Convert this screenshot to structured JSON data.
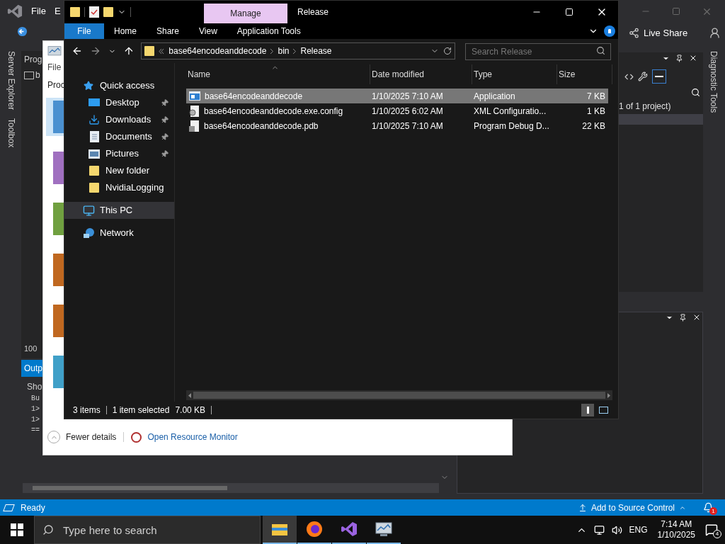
{
  "vs": {
    "menu": [
      "File",
      "E"
    ],
    "left_tabs": [
      "Server Explorer",
      "Toolbox"
    ],
    "right_tab": "Diagnostic Tools",
    "doc_tab": "Prog",
    "doc_item": "b",
    "zoom": "100",
    "output_tab": "Outp",
    "output_show": "Sho",
    "output_lines": [
      "Bu",
      "1>",
      "1>",
      "=="
    ],
    "solution_text": "1 of 1 project)",
    "live_share": "Live Share",
    "status": {
      "text": "Ready",
      "source_control": "Add to Source Control",
      "notifications": "1"
    }
  },
  "task_manager": {
    "menu": "File",
    "tab": "Proc",
    "fewer_details": "Fewer details",
    "resource_monitor": "Open Resource Monitor",
    "graphs": [
      {
        "color": "#4a90d0",
        "selected": true
      },
      {
        "color": "#a070c0",
        "selected": false
      },
      {
        "color": "#70a040",
        "selected": false
      },
      {
        "color": "#c06820",
        "selected": false
      },
      {
        "color": "#c06820",
        "selected": false
      },
      {
        "color": "#40a0c8",
        "selected": false
      }
    ]
  },
  "explorer": {
    "context_tab": "Manage",
    "title": "Release",
    "ribbon_tabs": [
      {
        "label": "File",
        "kind": "menu"
      },
      {
        "label": "Home",
        "kind": "tab"
      },
      {
        "label": "Share",
        "kind": "tab"
      },
      {
        "label": "View",
        "kind": "tab"
      },
      {
        "label": "Application Tools",
        "kind": "tab"
      }
    ],
    "breadcrumb": [
      "base64encodeanddecode",
      "bin",
      "Release"
    ],
    "search": {
      "placeholder": "Search Release"
    },
    "nav": [
      {
        "label": "Quick access",
        "kind": "star",
        "selected": false,
        "children": [
          {
            "label": "Desktop",
            "kind": "desktop",
            "pinned": true,
            "selected": false
          },
          {
            "label": "Downloads",
            "kind": "download",
            "pinned": true,
            "selected": false
          },
          {
            "label": "Documents",
            "kind": "document",
            "pinned": true,
            "selected": false
          },
          {
            "label": "Pictures",
            "kind": "pictures",
            "pinned": true,
            "selected": false
          },
          {
            "label": "New folder",
            "kind": "folder",
            "pinned": false,
            "selected": false
          },
          {
            "label": "NvidiaLogging",
            "kind": "folder",
            "pinned": false,
            "selected": false
          }
        ]
      },
      {
        "label": "This PC",
        "kind": "pc",
        "selected": true
      },
      {
        "label": "Network",
        "kind": "network",
        "selected": false
      }
    ],
    "columns": [
      "Name",
      "Date modified",
      "Type",
      "Size"
    ],
    "files": [
      {
        "name": "base64encodeanddecode",
        "kind": "app",
        "date": "1/10/2025 7:10 AM",
        "type": "Application",
        "size": "7 KB",
        "selected": true
      },
      {
        "name": "base64encodeanddecode.exe.config",
        "kind": "config",
        "date": "1/10/2025 6:02 AM",
        "type": "XML Configuratio...",
        "size": "1 KB",
        "selected": false
      },
      {
        "name": "base64encodeanddecode.pdb",
        "kind": "pdb",
        "date": "1/10/2025 7:10 AM",
        "type": "Program Debug D...",
        "size": "22 KB",
        "selected": false
      }
    ],
    "status": {
      "count": "3 items",
      "selection": "1 item selected",
      "size": "7.00 KB"
    }
  },
  "taskbar": {
    "search_placeholder": "Type here to search",
    "apps": [
      {
        "kind": "explorer",
        "selected": true
      },
      {
        "kind": "firefox",
        "selected": false
      },
      {
        "kind": "vs",
        "selected": false
      },
      {
        "kind": "taskmgr",
        "selected": false
      }
    ],
    "language": "ENG",
    "time": "7:14 AM",
    "date": "1/10/2025",
    "notifications": "4"
  }
}
